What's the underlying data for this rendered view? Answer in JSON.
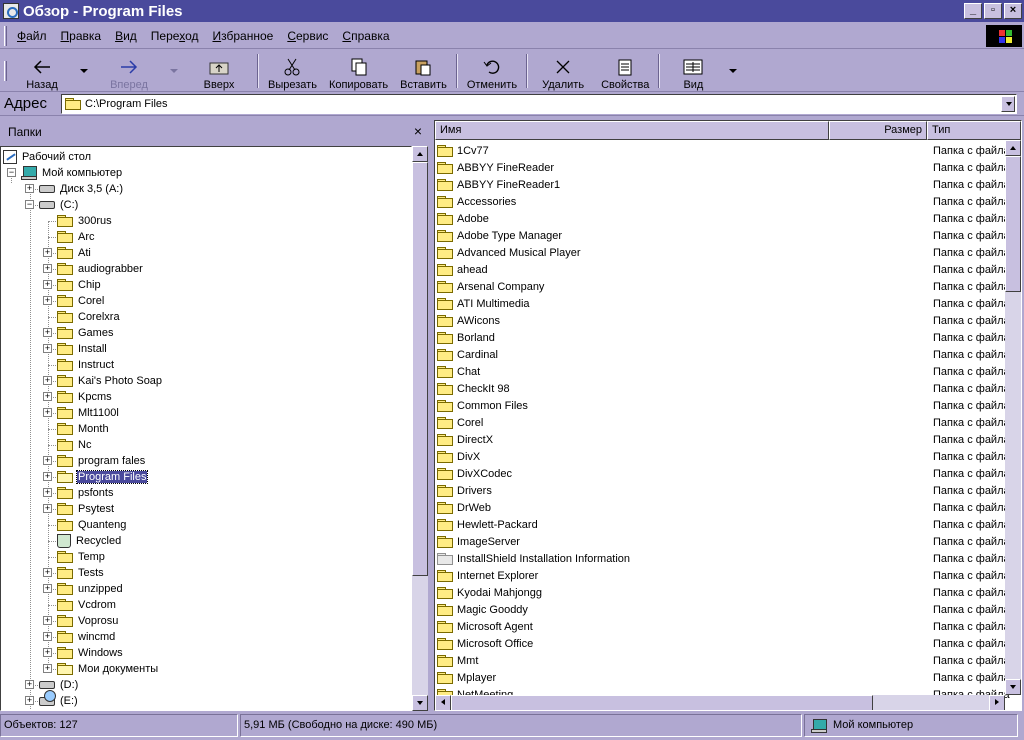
{
  "window": {
    "title": "Обзор - Program Files"
  },
  "menu": [
    "Файл",
    "Правка",
    "Вид",
    "Переход",
    "Избранное",
    "Сервис",
    "Справка"
  ],
  "menu_underline": [
    "Ф",
    "П",
    "В",
    "х",
    "И",
    "С",
    "С"
  ],
  "toolbar": {
    "back": "Назад",
    "forward": "Вперед",
    "up": "Вверх",
    "cut": "Вырезать",
    "copy": "Копировать",
    "paste": "Вставить",
    "undo": "Отменить",
    "delete": "Удалить",
    "properties": "Свойства",
    "view": "Вид"
  },
  "address": {
    "label": "Адрес",
    "value": "C:\\Program Files"
  },
  "folders_pane": {
    "title": "Папки",
    "close": "×",
    "items": [
      {
        "label": "Рабочий стол",
        "icon": "desktop-icon"
      },
      {
        "label": "Мой компьютер",
        "icon": "computer-icon"
      },
      {
        "label": "Диск 3,5 (A:)",
        "icon": "floppy-icon"
      },
      {
        "label": "(C:)",
        "icon": "drive-icon"
      },
      {
        "label": "300rus"
      },
      {
        "label": "Arc"
      },
      {
        "label": "Ati"
      },
      {
        "label": "audiograbber"
      },
      {
        "label": "Chip"
      },
      {
        "label": "Corel"
      },
      {
        "label": "Corelxra"
      },
      {
        "label": "Games"
      },
      {
        "label": "Install"
      },
      {
        "label": "Instruct"
      },
      {
        "label": "Kai's Photo Soap"
      },
      {
        "label": "Kpcms"
      },
      {
        "label": "Mlt1100l"
      },
      {
        "label": "Month"
      },
      {
        "label": "Nc"
      },
      {
        "label": "program fales"
      },
      {
        "label": "Program Files",
        "selected": true
      },
      {
        "label": "psfonts"
      },
      {
        "label": "Psytest"
      },
      {
        "label": "Quanteng"
      },
      {
        "label": "Recycled",
        "icon": "recycle-bin-icon"
      },
      {
        "label": "Temp"
      },
      {
        "label": "Tests"
      },
      {
        "label": "unzipped"
      },
      {
        "label": "Vcdrom"
      },
      {
        "label": "Voprosu"
      },
      {
        "label": "wincmd"
      },
      {
        "label": "Windows"
      },
      {
        "label": "Мои документы"
      },
      {
        "label": "(D:)",
        "icon": "drive-icon"
      },
      {
        "label": "(E:)",
        "icon": "cd-drive-icon"
      }
    ]
  },
  "file_list": {
    "columns": {
      "name": "Имя",
      "size": "Размер",
      "type": "Тип"
    },
    "type_text": "Папка с файла",
    "rows": [
      "1Cv77",
      "ABBYY FineReader",
      "ABBYY FineReader1",
      "Accessories",
      "Adobe",
      "Adobe Type Manager",
      "Advanced Musical Player",
      "ahead",
      "Arsenal Company",
      "ATI Multimedia",
      "AWicons",
      "Borland",
      "Cardinal",
      "Chat",
      "CheckIt 98",
      "Common Files",
      "Corel",
      "DirectX",
      "DivX",
      "DivXCodec",
      "Drivers",
      "DrWeb",
      "Hewlett-Packard",
      "ImageServer",
      "InstallShield Installation Information",
      "Internet Explorer",
      "Kyodai Mahjongg",
      "Magic Gooddy",
      "Microsoft Agent",
      "Microsoft Office",
      "Mmt",
      "Mplayer",
      "NetMeeting"
    ]
  },
  "status": {
    "objects": "Объектов: 127",
    "size": "5,91 МБ (Свободно на диске: 490 МБ)",
    "location": "Мой компьютер"
  }
}
